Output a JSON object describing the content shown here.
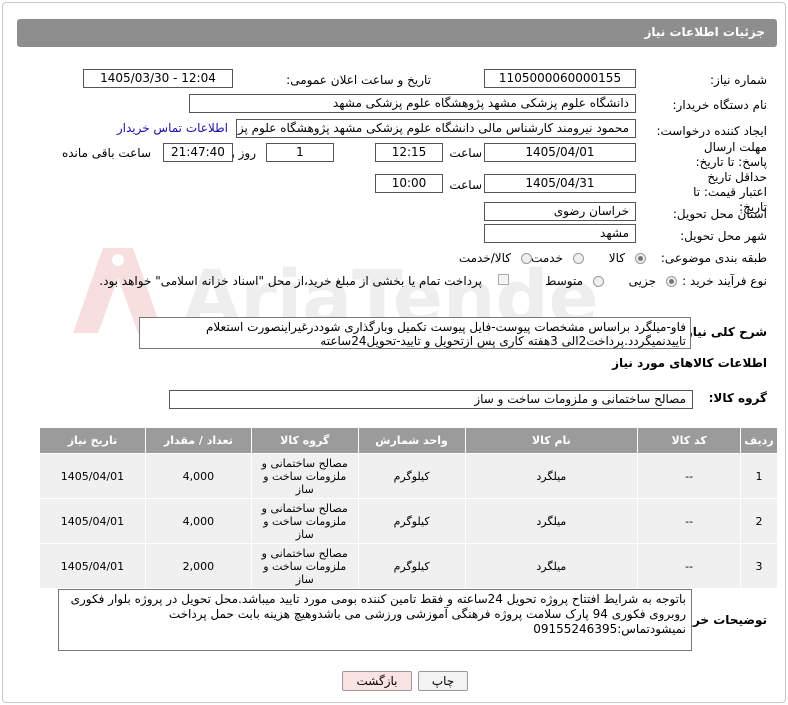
{
  "header": {
    "title": "جزئیات اطلاعات نیاز"
  },
  "fields": {
    "need_number_label": "شماره نیاز:",
    "need_number": "1105000060000155",
    "announce_label": "تاریخ و ساعت اعلان عمومی:",
    "announce_value": "1405/03/30 - 12:04",
    "buyer_org_label": "نام دستگاه خریدار:",
    "buyer_org": "دانشگاه علوم پزشکی مشهد   پژوهشگاه علوم پزشکی مشهد",
    "creator_label": "ایجاد کننده درخواست:",
    "creator": "محمود نیرومند کارشناس مالی دانشگاه علوم پزشکی مشهد   پژوهشگاه علوم پزشکی مشهد",
    "contact_link": "اطلاعات تماس خریدار",
    "deadline_label": "مهلت ارسال پاسخ: تا تاریخ:",
    "deadline_date": "1405/04/01",
    "time_label": "ساعت",
    "deadline_time": "12:15",
    "days_value": "1",
    "days_label": "روز و",
    "remaining_time": "21:47:40",
    "remaining_label": "ساعت باقی مانده",
    "validity_label": "حداقل تاریخ اعتبار قیمت: تا تاریخ:",
    "validity_date": "1405/04/31",
    "validity_time": "10:00",
    "province_label": "استان محل تحویل:",
    "province": "خراسان رضوی",
    "city_label": "شهر محل تحویل:",
    "city": "مشهد",
    "category_label": "طبقه بندی موضوعی:",
    "category_options": [
      "کالا",
      "خدمت",
      "کالا/خدمت"
    ],
    "category_selected": "کالا",
    "process_label": "نوع فرآیند خرید :",
    "process_options": [
      "جزیی",
      "متوسط"
    ],
    "process_selected": "جزیی",
    "payment_note": "پرداخت تمام یا بخشی از مبلغ خرید،از محل \"اسناد خزانه اسلامی\" خواهد بود."
  },
  "description": {
    "label": "شرح کلی نیاز:",
    "text": "فاو-میلگرد براساس مشخصات پیوست-فایل پیوست تکمیل وبارگذاری شوددرغیراینصورت استعلام تاییدنمیگردد.پرداخت2الی 3هفته کاری پس ازتحویل و تایید-تحویل24ساعته"
  },
  "goods": {
    "section_title": "اطلاعات کالاهای مورد نیاز",
    "group_label": "گروه کالا:",
    "group_value": "مصالح ساختمانی و ملزومات ساخت و ساز",
    "columns": [
      "ردیف",
      "کد کالا",
      "نام کالا",
      "واحد شمارش",
      "گروه کالا",
      "تعداد / مقدار",
      "تاریخ نیاز"
    ],
    "rows": [
      {
        "idx": "1",
        "code": "--",
        "name": "میلگرد",
        "unit": "کیلوگرم",
        "group": "مصالح ساختمانی و ملزومات ساخت و ساز",
        "qty": "4,000",
        "date": "1405/04/01"
      },
      {
        "idx": "2",
        "code": "--",
        "name": "میلگرد",
        "unit": "کیلوگرم",
        "group": "مصالح ساختمانی و ملزومات ساخت و ساز",
        "qty": "4,000",
        "date": "1405/04/01"
      },
      {
        "idx": "3",
        "code": "--",
        "name": "میلگرد",
        "unit": "کیلوگرم",
        "group": "مصالح ساختمانی و ملزومات ساخت و ساز",
        "qty": "2,000",
        "date": "1405/04/01"
      }
    ]
  },
  "buyer_notes": {
    "label": "توضیحات خریدار:",
    "text": "باتوجه به شرایط افتتاح پروژه تحویل 24ساعته و فقط تامین کننده بومی مورد تایید میباشد.محل تحویل در پروژه بلوار فکوری روبروی فکوری 94 پارک سلامت پروژه فرهنگی آموزشی ورزشی می باشدوهیچ هزینه بابت حمل  پرداخت نمیشودتماس:09155246395"
  },
  "buttons": {
    "print": "چاپ",
    "back": "بازگشت"
  },
  "watermark": "AriaTender.net"
}
